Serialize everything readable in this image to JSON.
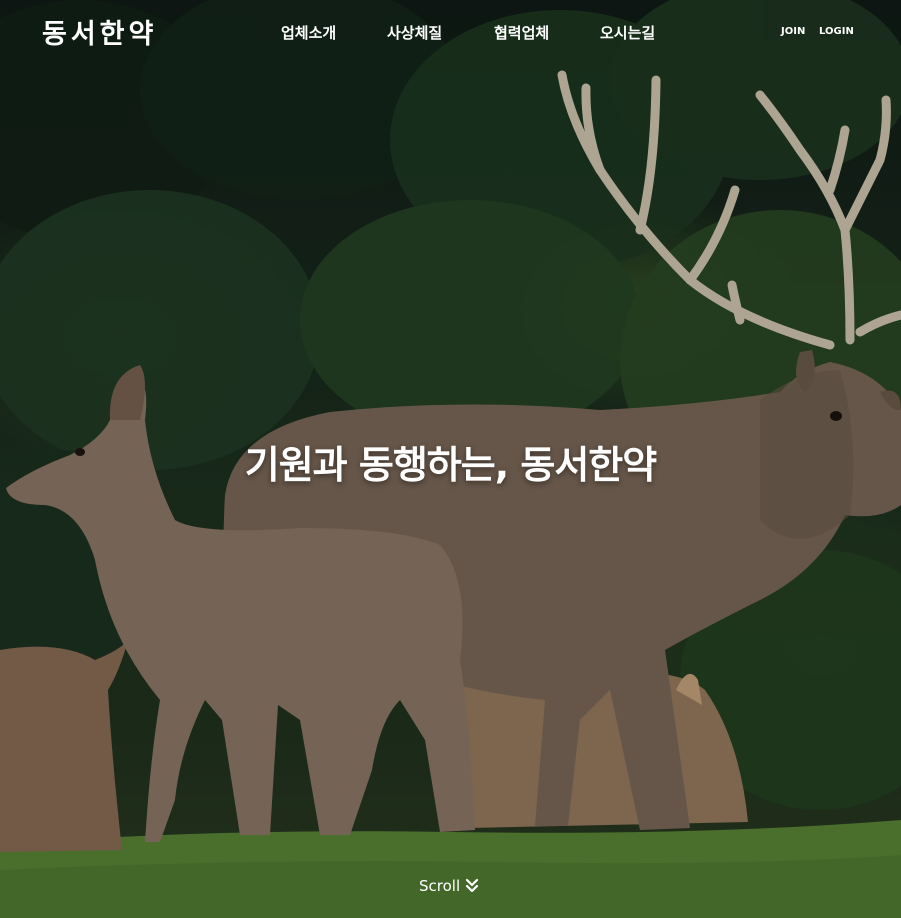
{
  "header": {
    "logo": "동서한약",
    "menu": [
      {
        "label": "업체소개"
      },
      {
        "label": "사상체질"
      },
      {
        "label": "협력업체"
      },
      {
        "label": "오시는길"
      }
    ],
    "auth": {
      "join": "JOIN",
      "login": "LOGIN"
    }
  },
  "hero": {
    "headline": "기원과 동행하는, 동서한약",
    "scroll_label": "Scroll",
    "scroll_icon": "double-chevron-down-icon"
  },
  "colors": {
    "foliage_dark": "#142419",
    "grass": "#5d8a3a",
    "deer_fur": "#8a7460",
    "antler": "#d8cdb8",
    "text": "#ffffff"
  }
}
